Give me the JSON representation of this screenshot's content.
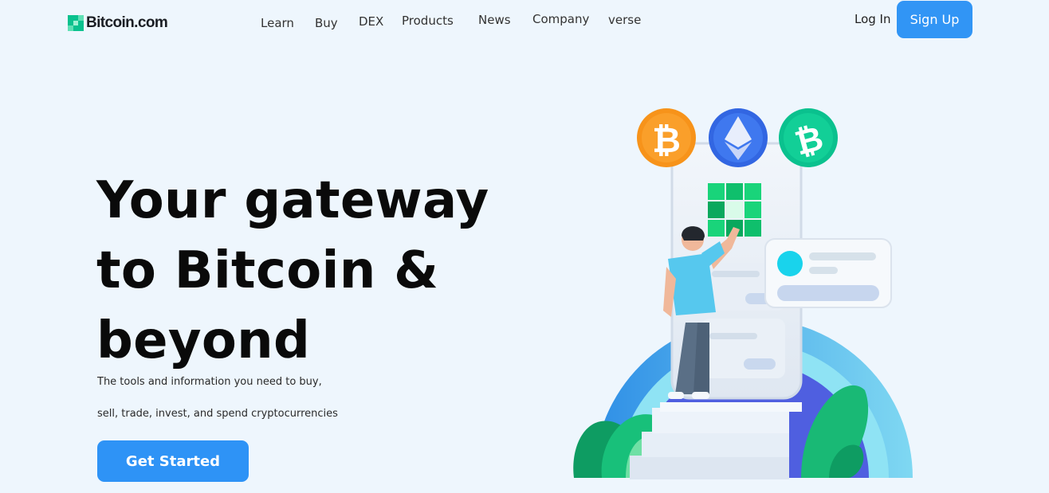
{
  "brand": {
    "name": "Bitcoin.com",
    "accent": "#0ac18e"
  },
  "nav": {
    "learn": "Learn",
    "buy": "Buy",
    "dex": "DEX",
    "products": "Products",
    "news": "News",
    "company": "Company",
    "verse": "verse"
  },
  "auth": {
    "login": "Log In",
    "signup": "Sign Up"
  },
  "hero": {
    "title_line1": "Your gateway",
    "title_line2": "to Bitcoin &",
    "title_line3": "beyond",
    "subtitle_line1": "The tools and information you need to buy,",
    "subtitle_line2": "sell, trade, invest, and spend cryptocurrencies",
    "cta": "Get Started"
  },
  "colors": {
    "button_blue": "#3195f5",
    "background": "#eef6fd"
  },
  "icons": [
    "bitcoin-coin-icon",
    "ethereum-coin-icon",
    "bitcoin-cash-coin-icon"
  ]
}
